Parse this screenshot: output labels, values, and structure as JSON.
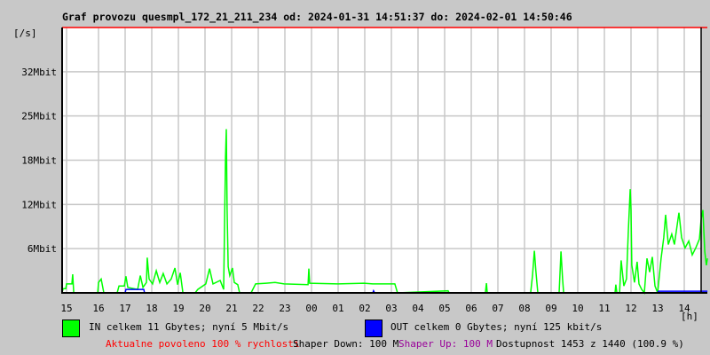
{
  "colors": {
    "in": "#00ff00",
    "out": "#0000ff",
    "limit": "#ff0000",
    "shaper_up": "#990099",
    "grid": "#c8c8c8"
  },
  "chart_data": {
    "type": "line",
    "title": "Graf provozu quesmpl_172_21_211_234 od: 2024-01-31 14:51:37 do: 2024-02-01 14:50:46",
    "ylabel": "[/s]",
    "xlabel": "[h]",
    "ylim": [
      0,
      38.4
    ],
    "xlim": [
      -0.37,
      23.87
    ],
    "x_unit": "hours after 2024-01-31 15:00",
    "y_unit": "Mbit/s",
    "yticks": [
      {
        "v": 6.4,
        "label": "6Mbit"
      },
      {
        "v": 12.8,
        "label": "12Mbit"
      },
      {
        "v": 19.2,
        "label": "18Mbit"
      },
      {
        "v": 25.6,
        "label": "25Mbit"
      },
      {
        "v": 32,
        "label": "32Mbit"
      }
    ],
    "xticks": [
      {
        "h": -0.2,
        "label": "15"
      },
      {
        "h": 1,
        "label": "16"
      },
      {
        "h": 2,
        "label": "17"
      },
      {
        "h": 3,
        "label": "18"
      },
      {
        "h": 4,
        "label": "19"
      },
      {
        "h": 5,
        "label": "20"
      },
      {
        "h": 6,
        "label": "21"
      },
      {
        "h": 7,
        "label": "22"
      },
      {
        "h": 8,
        "label": "23"
      },
      {
        "h": 9,
        "label": "00"
      },
      {
        "h": 10,
        "label": "01"
      },
      {
        "h": 11,
        "label": "02"
      },
      {
        "h": 12,
        "label": "03"
      },
      {
        "h": 13,
        "label": "04"
      },
      {
        "h": 14,
        "label": "05"
      },
      {
        "h": 15,
        "label": "06"
      },
      {
        "h": 16,
        "label": "07"
      },
      {
        "h": 17,
        "label": "08"
      },
      {
        "h": 18,
        "label": "09"
      },
      {
        "h": 19,
        "label": "10"
      },
      {
        "h": 20,
        "label": "11"
      },
      {
        "h": 21,
        "label": "12"
      },
      {
        "h": 22,
        "label": "13"
      },
      {
        "h": 23,
        "label": "14"
      }
    ],
    "grid": true,
    "series": [
      {
        "name": "IN",
        "points": [
          [
            -0.37,
            0
          ],
          [
            -0.33,
            0.6
          ],
          [
            -0.23,
            0.6
          ],
          [
            -0.2,
            1.3
          ],
          [
            0,
            1.3
          ],
          [
            0.03,
            2.7
          ],
          [
            0.07,
            0
          ],
          [
            0.97,
            0
          ],
          [
            1.0,
            1.5
          ],
          [
            1.1,
            2
          ],
          [
            1.2,
            0
          ],
          [
            1.7,
            0
          ],
          [
            1.77,
            1
          ],
          [
            1.97,
            1
          ],
          [
            2.03,
            2.4
          ],
          [
            2.1,
            0.8
          ],
          [
            2.47,
            0.5
          ],
          [
            2.57,
            2.5
          ],
          [
            2.67,
            0.8
          ],
          [
            2.8,
            1.5
          ],
          [
            2.83,
            5.1
          ],
          [
            2.9,
            2
          ],
          [
            3.03,
            1.3
          ],
          [
            3.17,
            3.2
          ],
          [
            3.3,
            1.5
          ],
          [
            3.43,
            2.8
          ],
          [
            3.57,
            1.3
          ],
          [
            3.73,
            2.0
          ],
          [
            3.87,
            3.6
          ],
          [
            3.97,
            1.2
          ],
          [
            4.07,
            2.9
          ],
          [
            4.17,
            0
          ],
          [
            4.63,
            0
          ],
          [
            4.73,
            0.5
          ],
          [
            5.03,
            1.3
          ],
          [
            5.17,
            3.5
          ],
          [
            5.3,
            1.3
          ],
          [
            5.57,
            1.8
          ],
          [
            5.7,
            0.5
          ],
          [
            5.77,
            19.6
          ],
          [
            5.8,
            23.7
          ],
          [
            5.83,
            11.9
          ],
          [
            5.87,
            3.8
          ],
          [
            5.93,
            2.5
          ],
          [
            6.03,
            3.6
          ],
          [
            6.1,
            1.5
          ],
          [
            6.23,
            1.2
          ],
          [
            6.3,
            0
          ],
          [
            6.73,
            0
          ],
          [
            6.9,
            1.3
          ],
          [
            7.3,
            1.4
          ],
          [
            7.63,
            1.5
          ],
          [
            7.97,
            1.3
          ],
          [
            8.87,
            1.2
          ],
          [
            8.9,
            3.5
          ],
          [
            8.93,
            1.4
          ],
          [
            9.97,
            1.3
          ],
          [
            10.97,
            1.4
          ],
          [
            11.3,
            1.3
          ],
          [
            12.13,
            1.3
          ],
          [
            12.23,
            0
          ],
          [
            14.13,
            0.3
          ],
          [
            14.17,
            0
          ],
          [
            15.53,
            0
          ],
          [
            15.57,
            1.4
          ],
          [
            15.6,
            0
          ],
          [
            17.23,
            0
          ],
          [
            17.3,
            2.5
          ],
          [
            17.37,
            6.1
          ],
          [
            17.43,
            3
          ],
          [
            17.5,
            0
          ],
          [
            18.3,
            0
          ],
          [
            18.37,
            6
          ],
          [
            18.43,
            2
          ],
          [
            18.47,
            0
          ],
          [
            20.4,
            0
          ],
          [
            20.43,
            1.2
          ],
          [
            20.47,
            0
          ],
          [
            20.57,
            0
          ],
          [
            20.63,
            4.7
          ],
          [
            20.73,
            1
          ],
          [
            20.83,
            2
          ],
          [
            20.9,
            9
          ],
          [
            20.97,
            15
          ],
          [
            21.0,
            12
          ],
          [
            21.03,
            4
          ],
          [
            21.13,
            1.5
          ],
          [
            21.23,
            4.5
          ],
          [
            21.3,
            1.3
          ],
          [
            21.4,
            0.5
          ],
          [
            21.5,
            0
          ],
          [
            21.6,
            5
          ],
          [
            21.7,
            3
          ],
          [
            21.8,
            5.2
          ],
          [
            21.9,
            1
          ],
          [
            22.0,
            0
          ],
          [
            22.13,
            5
          ],
          [
            22.23,
            8
          ],
          [
            22.3,
            11.3
          ],
          [
            22.4,
            7
          ],
          [
            22.53,
            8.5
          ],
          [
            22.63,
            7
          ],
          [
            22.8,
            11.6
          ],
          [
            22.9,
            8
          ],
          [
            23.03,
            6.5
          ],
          [
            23.17,
            7.5
          ],
          [
            23.3,
            5.5
          ],
          [
            23.43,
            6.5
          ],
          [
            23.57,
            7.8
          ],
          [
            23.63,
            10.5
          ],
          [
            23.7,
            12
          ],
          [
            23.77,
            6
          ],
          [
            23.83,
            4
          ],
          [
            23.87,
            5
          ]
        ]
      },
      {
        "name": "OUT",
        "points": [
          [
            -0.37,
            0
          ],
          [
            2.0,
            0
          ],
          [
            2.03,
            0.5
          ],
          [
            2.7,
            0.5
          ],
          [
            2.73,
            0
          ],
          [
            11.3,
            0
          ],
          [
            11.33,
            0.3
          ],
          [
            11.37,
            0
          ],
          [
            22.0,
            0
          ],
          [
            22.03,
            0.25
          ],
          [
            23.87,
            0.25
          ]
        ]
      }
    ]
  },
  "legend": {
    "in": "IN celkem 11 Gbytes; nyní 5 Mbit/s",
    "out": "OUT celkem 0 Gbytes; nyní 125 kbit/s"
  },
  "footer": {
    "allowed": "Aktualne povoleno 100 % rychlosti",
    "shaper_down": "Shaper Down: 100 M",
    "shaper_up": "Shaper Up: 100 M",
    "availability": "Dostupnost 1453 z 1440 (100.9 %)"
  }
}
